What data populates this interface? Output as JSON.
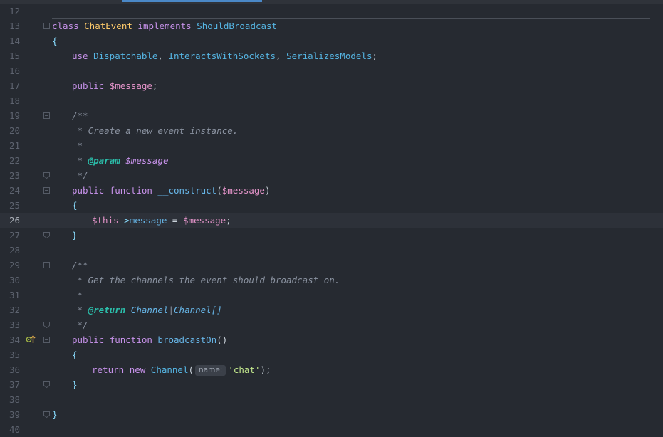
{
  "colors": {
    "background": "#262a31",
    "keyword": "#c792ea",
    "class": "#ffcb6b",
    "type": "#56b6e4",
    "variable": "#e293c8",
    "string": "#c3e88d",
    "comment": "#8a92a0",
    "doc_tag": "#2bbfab"
  },
  "editor": {
    "current_line": "26",
    "lines": [
      {
        "num": "12"
      },
      {
        "num": "13",
        "t": [
          "class ",
          "ChatEvent",
          " implements ",
          "ShouldBroadcast"
        ]
      },
      {
        "num": "14",
        "t": [
          "{"
        ]
      },
      {
        "num": "15",
        "t": [
          "use ",
          "Dispatchable",
          ", ",
          "InteractsWithSockets",
          ", ",
          "SerializesModels",
          ";"
        ]
      },
      {
        "num": "16"
      },
      {
        "num": "17",
        "t": [
          "public ",
          "$message",
          ";"
        ]
      },
      {
        "num": "18"
      },
      {
        "num": "19",
        "t": [
          "/**"
        ]
      },
      {
        "num": "20",
        "t": [
          " * Create a new event instance."
        ]
      },
      {
        "num": "21",
        "t": [
          " *"
        ]
      },
      {
        "num": "22",
        "t": [
          " * ",
          "@param",
          " ",
          "$message"
        ]
      },
      {
        "num": "23",
        "t": [
          " */"
        ]
      },
      {
        "num": "24",
        "t": [
          "public ",
          "function ",
          "__construct",
          "(",
          "$message",
          ")"
        ]
      },
      {
        "num": "25",
        "t": [
          "{"
        ]
      },
      {
        "num": "26",
        "t": [
          "$this",
          "->",
          "message",
          " = ",
          "$message",
          ";"
        ]
      },
      {
        "num": "27",
        "t": [
          "}"
        ]
      },
      {
        "num": "28"
      },
      {
        "num": "29",
        "t": [
          "/**"
        ]
      },
      {
        "num": "30",
        "t": [
          " * Get the channels the event should broadcast on."
        ]
      },
      {
        "num": "31",
        "t": [
          " *"
        ]
      },
      {
        "num": "32",
        "t": [
          " * ",
          "@return",
          " ",
          "Channel",
          "|",
          "Channel[]"
        ]
      },
      {
        "num": "33",
        "t": [
          " */"
        ]
      },
      {
        "num": "34",
        "t": [
          "public ",
          "function ",
          "broadcastOn",
          "()"
        ],
        "gutter_icon": "implements-method-icon"
      },
      {
        "num": "35",
        "t": [
          "{"
        ]
      },
      {
        "num": "36",
        "t": [
          "return ",
          "new ",
          "Channel",
          "(",
          "name:",
          "'chat'",
          ");"
        ]
      },
      {
        "num": "37",
        "t": [
          "}"
        ]
      },
      {
        "num": "38"
      },
      {
        "num": "39",
        "t": [
          "}"
        ]
      },
      {
        "num": "40"
      }
    ]
  }
}
